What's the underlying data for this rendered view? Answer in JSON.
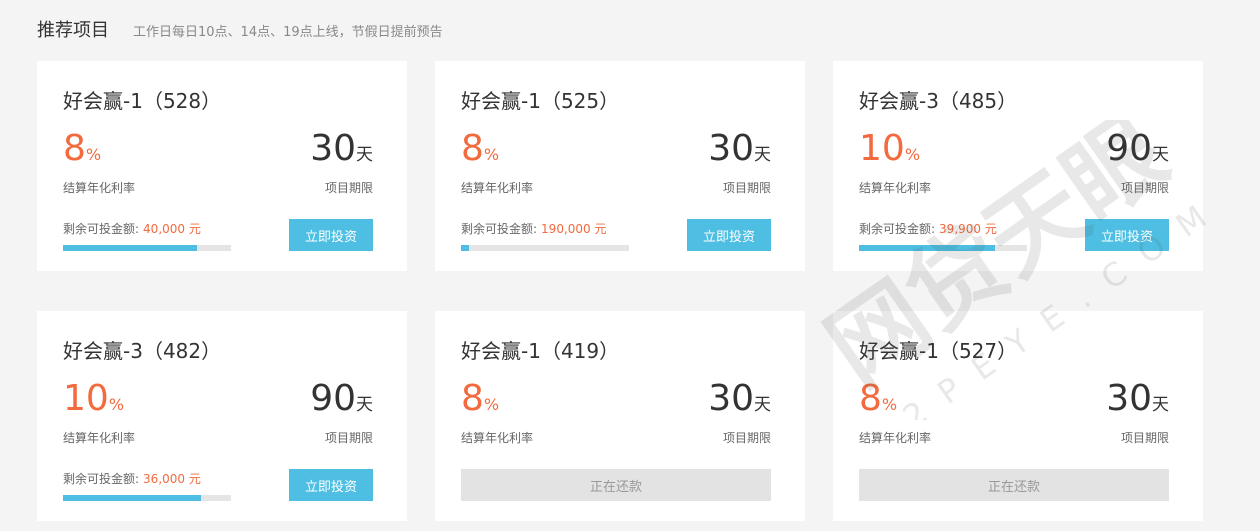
{
  "header": {
    "title": "推荐项目",
    "subtitle": "工作日每日10点、14点、19点上线，节假日提前预告"
  },
  "labels": {
    "rate_label": "结算年化利率",
    "term_label": "项目期限",
    "remain_label": "剩余可投金额:",
    "rate_unit": "%",
    "term_unit": "天"
  },
  "cards": [
    {
      "title": "好会赢-1（528）",
      "rate": "8",
      "term": "30",
      "remain": "40,000 元",
      "progress": 0.8,
      "button": "立即投资",
      "status": "invest"
    },
    {
      "title": "好会赢-1（525）",
      "rate": "8",
      "term": "30",
      "remain": "190,000 元",
      "progress": 0.05,
      "button": "立即投资",
      "status": "invest"
    },
    {
      "title": "好会赢-3（485）",
      "rate": "10",
      "term": "90",
      "remain": "39,900 元",
      "progress": 0.81,
      "button": "立即投资",
      "status": "invest"
    },
    {
      "title": "好会赢-3（482）",
      "rate": "10",
      "term": "90",
      "remain": "36,000 元",
      "progress": 0.82,
      "button": "立即投资",
      "status": "invest"
    },
    {
      "title": "好会赢-1（419）",
      "rate": "8",
      "term": "30",
      "button": "正在还款",
      "status": "repaying"
    },
    {
      "title": "好会赢-1（527）",
      "rate": "8",
      "term": "30",
      "button": "正在还款",
      "status": "repaying"
    }
  ],
  "watermark": {
    "text": "网贷天眼",
    "sub": "P2PEYE.COM"
  },
  "colors": {
    "accent": "#f26a3e",
    "button": "#4ebfe2",
    "disabled": "#e3e3e3"
  }
}
